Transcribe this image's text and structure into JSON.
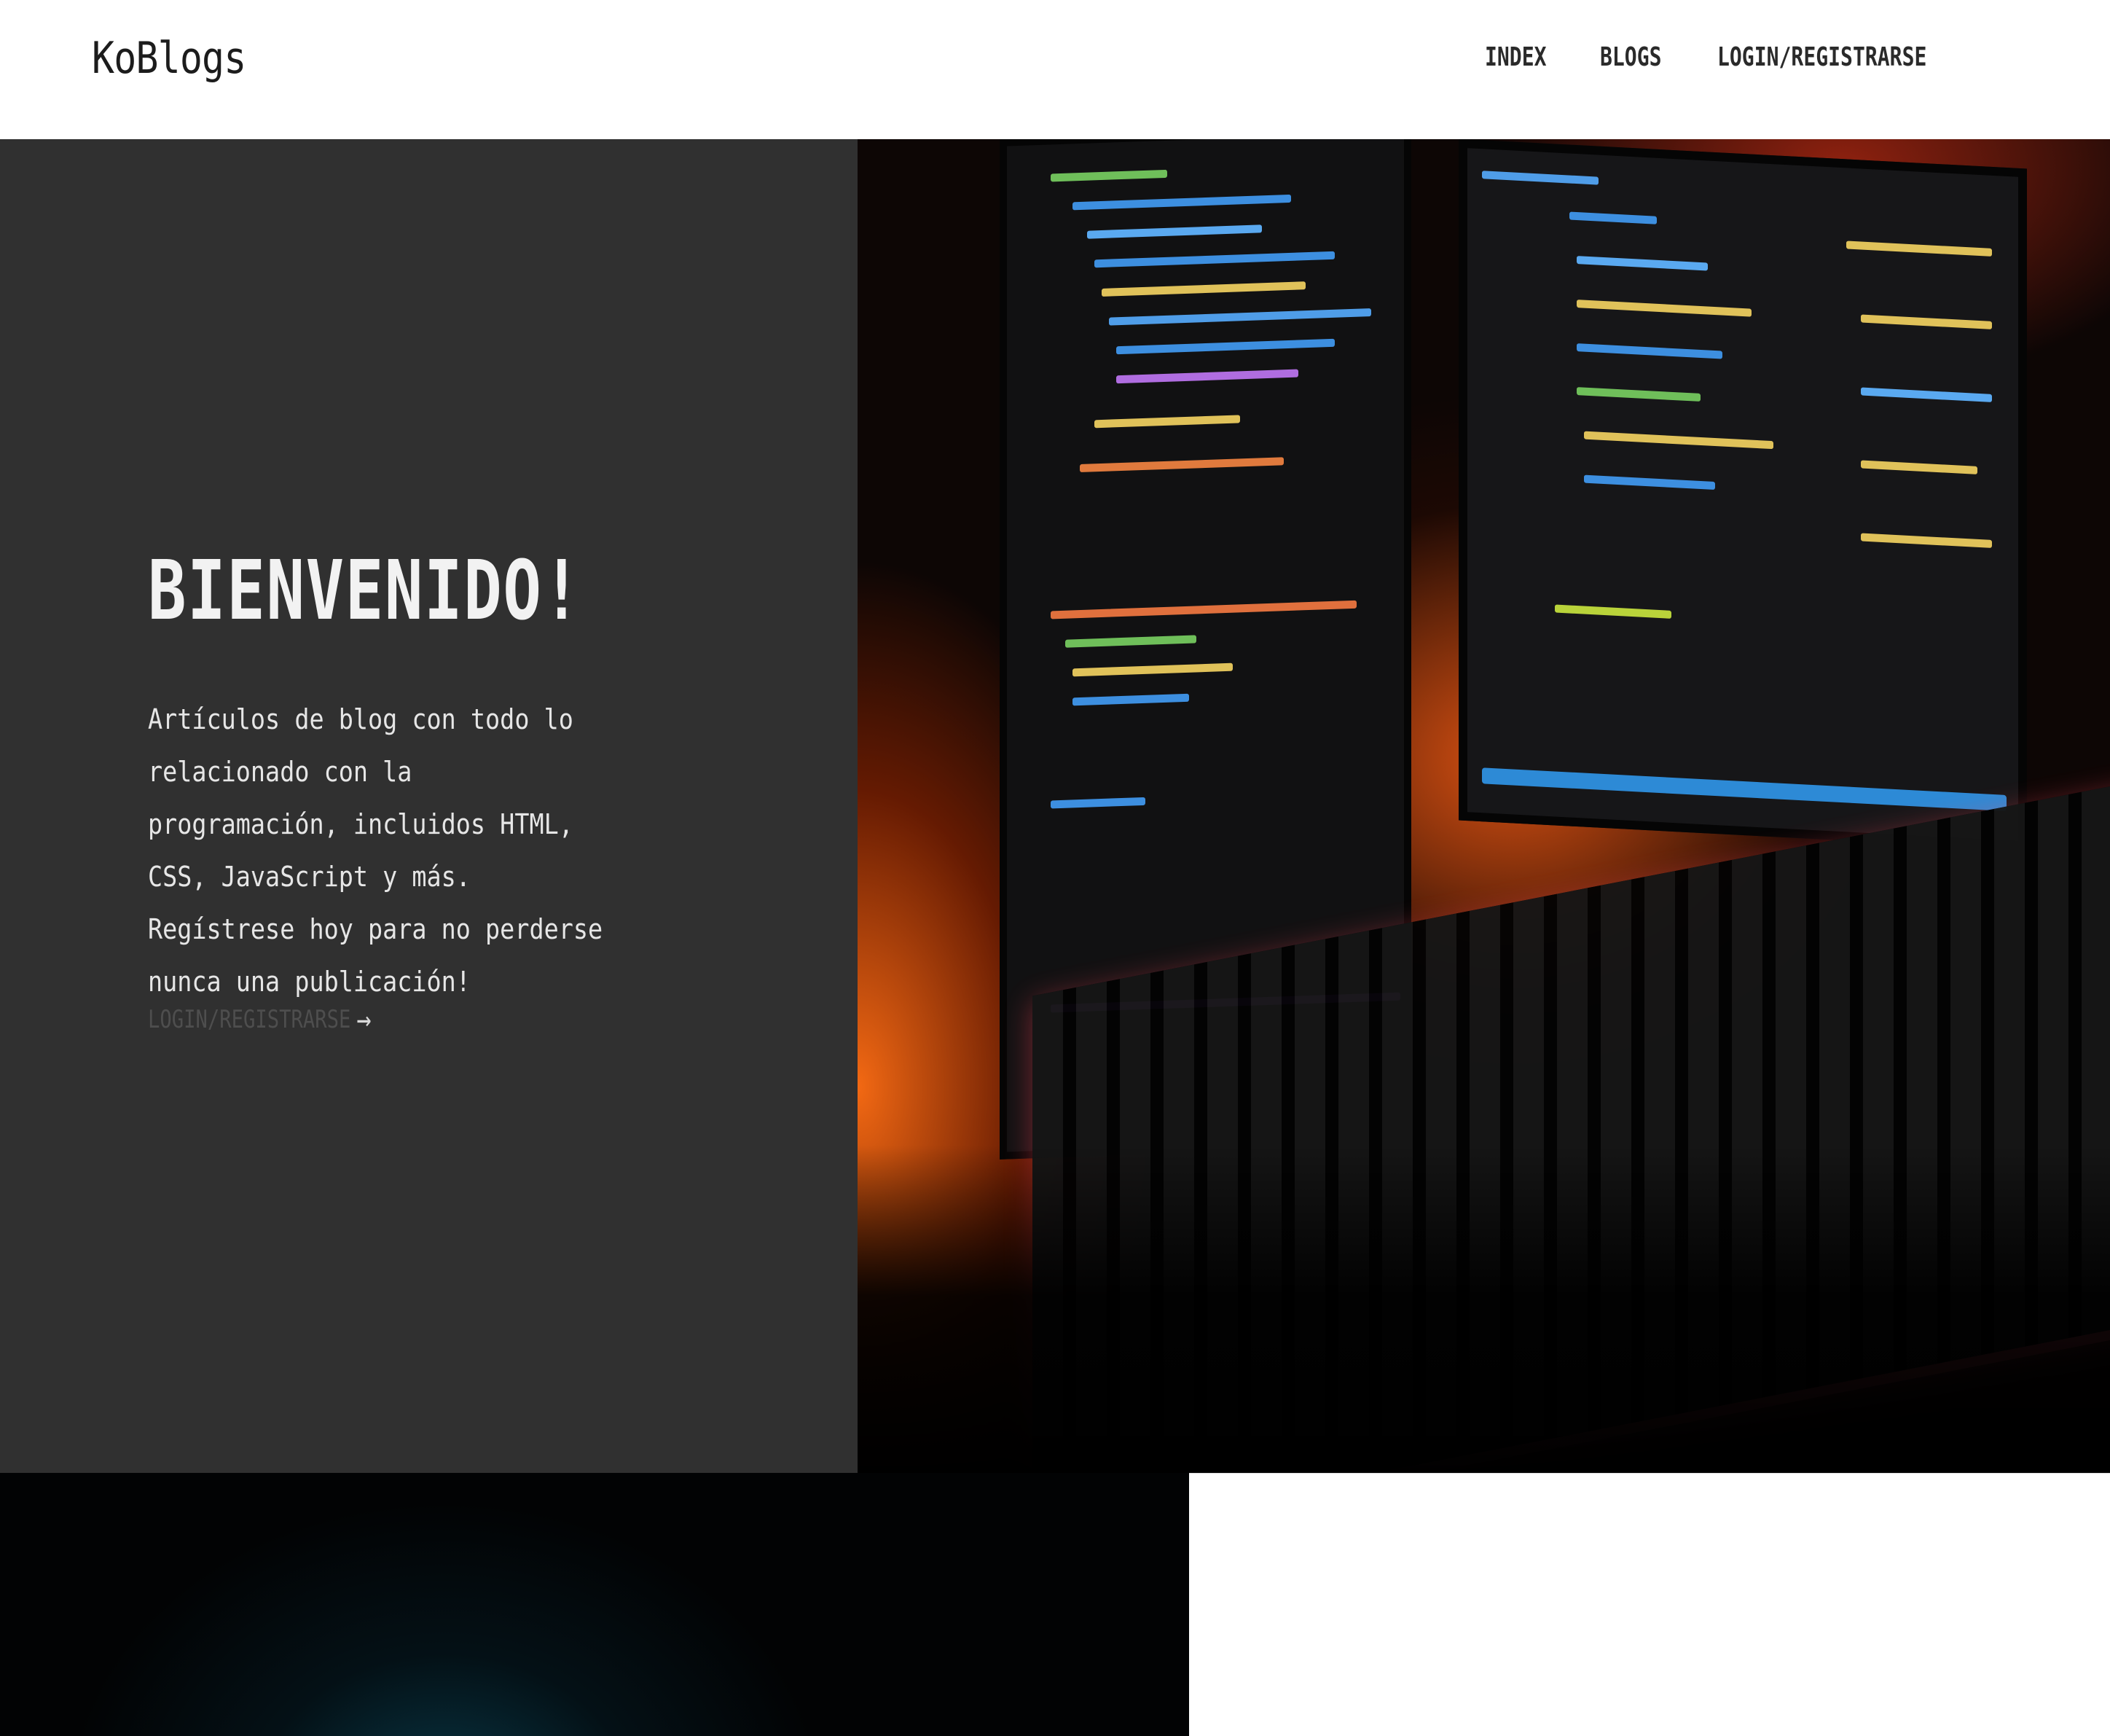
{
  "navbar": {
    "brand": "KoBlogs",
    "links": [
      {
        "label": "INDEX"
      },
      {
        "label": "BLOGS"
      },
      {
        "label": "LOGIN/REGISTRARSE"
      }
    ]
  },
  "hero": {
    "title": "BIENVENIDO!",
    "description": "Artículos de blog con todo lo relacionado con la programación, incluidos HTML, CSS, JavaScript y más. Regístrese hoy para no perderse nunca una publicación!",
    "cta_label": "LOGIN/REGISTRARSE",
    "cta_icon": "arrow-right-icon",
    "image": "monitors-and-keyboard-photo"
  },
  "colors": {
    "hero_panel": "#303030",
    "hero_text": "#f2f2f2",
    "cta_text": "#4e4e4e",
    "navbar_bg": "#ffffff",
    "bottom_dark": "#020304"
  }
}
